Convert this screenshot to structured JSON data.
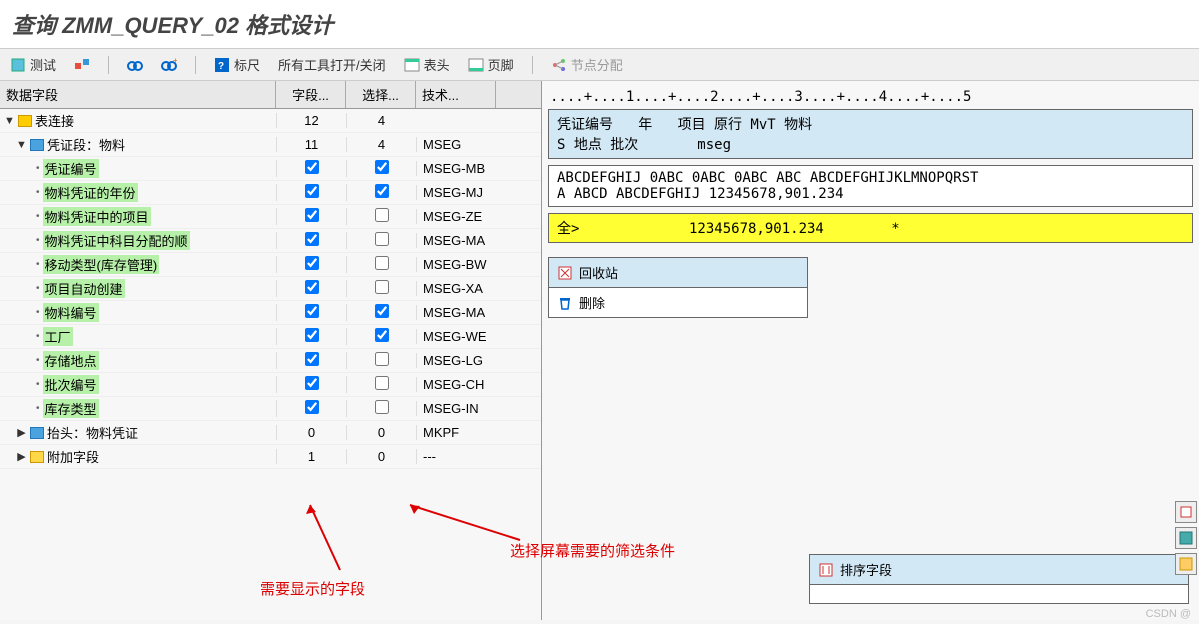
{
  "title": "查询 ZMM_QUERY_02 格式设计",
  "toolbar": {
    "test": "测试",
    "ruler_label": "标尺",
    "tools_toggle": "所有工具打开/关闭",
    "header": "表头",
    "footer": "页脚",
    "node_assign": "节点分配"
  },
  "grid": {
    "col_name": "数据字段",
    "col_field": "字段...",
    "col_sel": "选择...",
    "col_tech": "技术..."
  },
  "tree": {
    "root": {
      "label": "表连接",
      "field": "12",
      "sel": "4",
      "tech": ""
    },
    "mseg": {
      "label": "凭证段：物料",
      "field": "11",
      "sel": "4",
      "tech": "MSEG"
    },
    "rows": [
      {
        "label": "凭证编号",
        "fchk": true,
        "schk": true,
        "tech": "MSEG-MB",
        "hl": true
      },
      {
        "label": "物料凭证的年份",
        "fchk": true,
        "schk": true,
        "tech": "MSEG-MJ",
        "hl": true
      },
      {
        "label": "物料凭证中的项目",
        "fchk": true,
        "schk": false,
        "tech": "MSEG-ZE",
        "hl": true
      },
      {
        "label": "物料凭证中科目分配的顺",
        "fchk": true,
        "schk": false,
        "tech": "MSEG-MA",
        "hl": true
      },
      {
        "label": "移动类型(库存管理)",
        "fchk": true,
        "schk": false,
        "tech": "MSEG-BW",
        "hl": true
      },
      {
        "label": "项目自动创建",
        "fchk": true,
        "schk": false,
        "tech": "MSEG-XA",
        "hl": true
      },
      {
        "label": "物料编号",
        "fchk": true,
        "schk": true,
        "tech": "MSEG-MA",
        "hl": true
      },
      {
        "label": "工厂",
        "fchk": true,
        "schk": true,
        "tech": "MSEG-WE",
        "hl": true
      },
      {
        "label": "存储地点",
        "fchk": true,
        "schk": false,
        "tech": "MSEG-LG",
        "hl": true
      },
      {
        "label": "批次编号",
        "fchk": true,
        "schk": false,
        "tech": "MSEG-CH",
        "hl": true
      },
      {
        "label": "库存类型",
        "fchk": true,
        "schk": false,
        "tech": "MSEG-IN",
        "hl": true
      }
    ],
    "mkpf": {
      "label": "抬头：物料凭证",
      "field": "0",
      "sel": "0",
      "tech": "MKPF"
    },
    "addl": {
      "label": "附加字段",
      "field": "1",
      "sel": "0",
      "tech": "---"
    }
  },
  "ruler_text": "....+....1....+....2....+....3....+....4....+....5",
  "preview": {
    "header1": "凭证编号   年   项目 原行 MvT 物料",
    "header2": "S 地点 批次       mseg",
    "body1": "ABCDEFGHIJ 0ABC 0ABC 0ABC ABC ABCDEFGHIJKLMNOPQRST",
    "body2": "A ABCD ABCDEFGHIJ 12345678,901.234",
    "total": "全>             12345678,901.234        *"
  },
  "panels": {
    "recycle": "回收站",
    "delete": "删除",
    "sort": "排序字段"
  },
  "annotations": {
    "fields_needed": "需要显示的字段",
    "filter_cond": "选择屏幕需要的筛选条件"
  },
  "watermark": "CSDN @"
}
